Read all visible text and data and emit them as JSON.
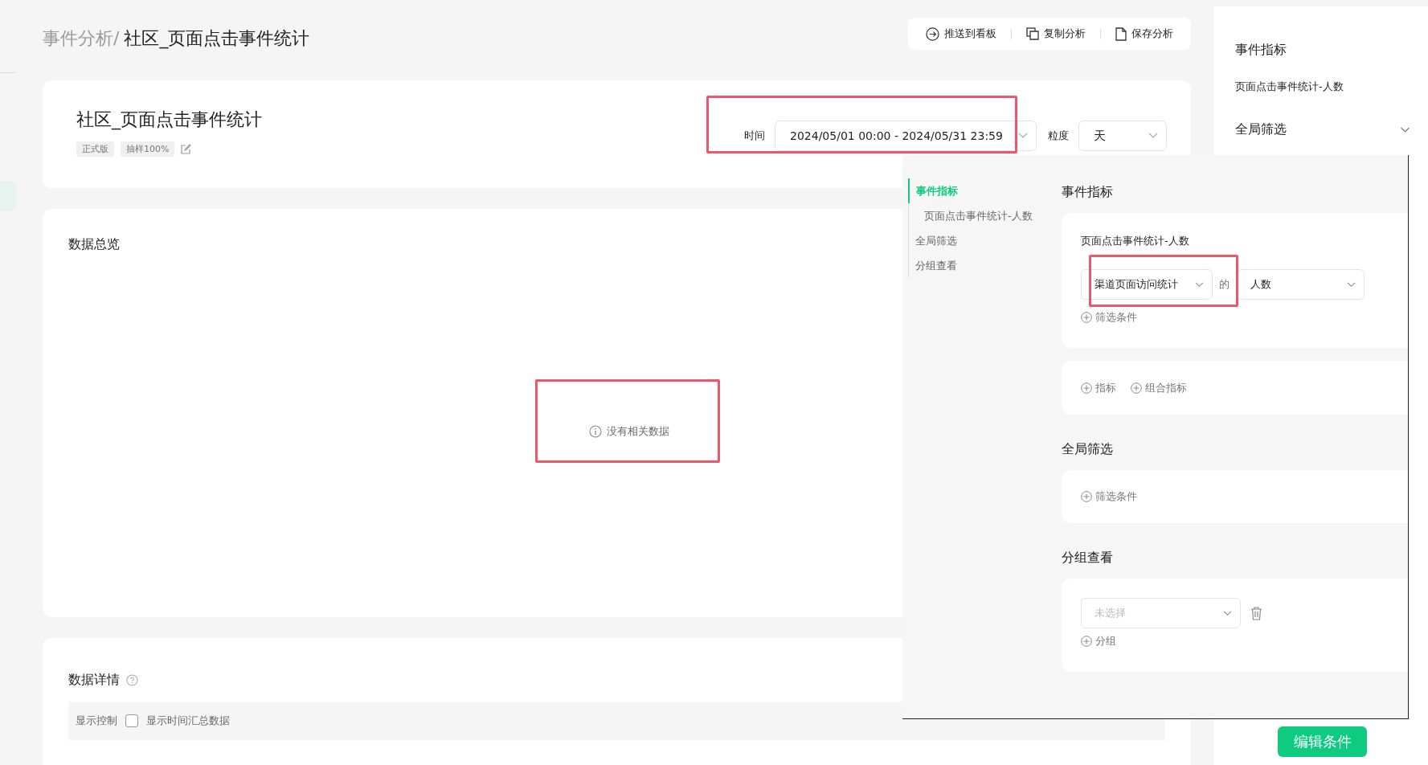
{
  "breadcrumb": {
    "parent": "事件分析/",
    "current": "社区_页面点击事件统计"
  },
  "toolbar": [
    {
      "label": "推送到看板",
      "kind": "push"
    },
    {
      "label": "复制分析",
      "kind": "copy"
    },
    {
      "label": "保存分析",
      "kind": "save"
    }
  ],
  "report": {
    "title": "社区_页面点击事件统计",
    "tags": [
      "正式版",
      "抽样100%"
    ],
    "time_label": "时间",
    "time_value": "2024/05/01 00:00 - 2024/05/31 23:59",
    "granularity_label": "粒度",
    "granularity_value": "天"
  },
  "overview": {
    "title": "数据总览",
    "empty_text": "没有相关数据"
  },
  "details": {
    "title": "数据详情",
    "control_label": "显示控制",
    "checkbox": {
      "label": "显示时间汇总数据",
      "checked": false
    }
  },
  "side_panel": {
    "metric_title": "事件指标",
    "metric_item": "页面点击事件统计-人数",
    "filter_title": "全局筛选",
    "filter_expanded": false,
    "edit_button": "编辑条件"
  },
  "editor": {
    "nav": [
      {
        "label": "事件指标",
        "selected": true,
        "children": [
          {
            "label": "页面点击事件统计-人数",
            "selected": false
          }
        ]
      },
      {
        "label": "全局筛选",
        "selected": false
      },
      {
        "label": "分组查看",
        "selected": false
      }
    ],
    "metric": {
      "title": "事件指标",
      "name": "页面点击事件统计-人数",
      "event": "渠道页面访问统计",
      "connector": "的",
      "measure": "人数",
      "add_filter": "筛选条件",
      "add_metric": "指标",
      "add_combined": "组合指标"
    },
    "global_filter": {
      "title": "全局筛选",
      "add_filter": "筛选条件"
    },
    "group": {
      "title": "分组查看",
      "placeholder": "未选择",
      "add_group": "分组"
    }
  }
}
